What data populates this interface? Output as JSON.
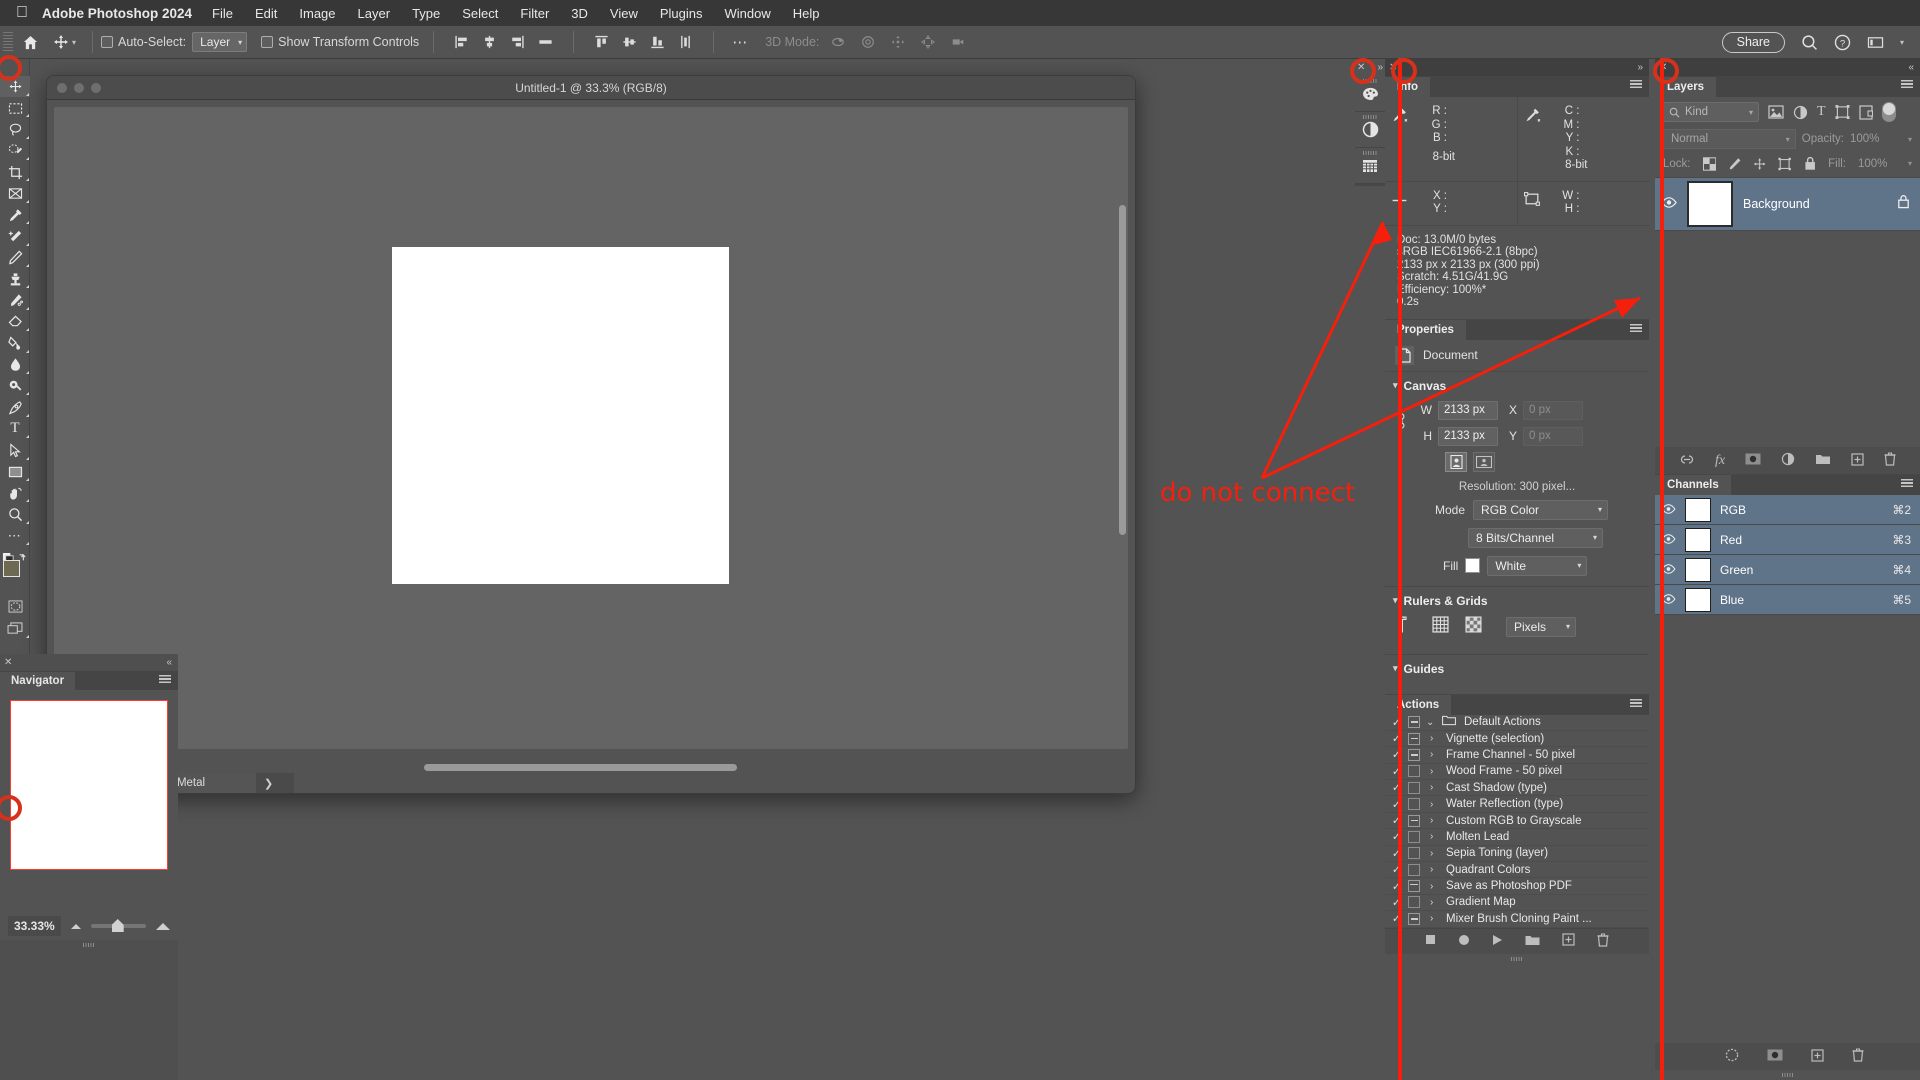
{
  "colors": {
    "annotation_red": "#f61f0c",
    "panel_bg": "#535353",
    "selection_blue": "#5f7389",
    "app_chrome": "#373737"
  },
  "menubar": {
    "apple_glyph": "apple-logo",
    "app_name": "Adobe Photoshop 2024",
    "items": [
      "File",
      "Edit",
      "Image",
      "Layer",
      "Type",
      "Select",
      "Filter",
      "3D",
      "View",
      "Plugins",
      "Window",
      "Help"
    ]
  },
  "optionsbar": {
    "home_icon": "home-icon",
    "tool_icon": "move-tool-icon",
    "auto_select_label": "Auto-Select:",
    "auto_select_checked": false,
    "layer_dropdown_value": "Layer",
    "show_transform_label": "Show Transform Controls",
    "show_transform_checked": false,
    "align_icons": [
      "align-left-edges-icon",
      "align-horizontal-centers-icon",
      "align-right-edges-icon",
      "align-center-icon"
    ],
    "distribute_icons": [
      "align-top-edges-icon",
      "align-vertical-centers-icon",
      "align-bottom-edges-icon",
      "distribute-vertical-icon"
    ],
    "more_icon": "ellipsis-icon",
    "mode3d_label": "3D Mode:",
    "mode3d_icons": [
      "orbit-3d-icon",
      "roll-3d-icon",
      "pan-3d-icon",
      "slide-3d-icon",
      "camera-3d-icon"
    ],
    "share_label": "Share",
    "search_icon": "search-icon",
    "help_icon": "help-circle-icon",
    "workspace_icon": "workspace-icon",
    "workspace_caret": "chevron-down-icon"
  },
  "toolbar": {
    "close_icon": "close-icon",
    "expand_icon": "double-chevron-right-icon",
    "tools": [
      {
        "name": "move-tool",
        "glyph": "✛",
        "active": true
      },
      {
        "name": "rectangular-marquee-tool",
        "glyph": "⬚",
        "active": false
      },
      {
        "name": "lasso-tool",
        "glyph": "◯",
        "active": false
      },
      {
        "name": "object-selection-tool",
        "glyph": "✐",
        "active": false
      },
      {
        "name": "crop-tool",
        "glyph": "⌙",
        "active": false
      },
      {
        "name": "frame-tool",
        "glyph": "⌧",
        "active": false
      },
      {
        "name": "eyedropper-tool",
        "glyph": "✒",
        "active": false
      },
      {
        "name": "spot-healing-brush-tool",
        "glyph": "✦",
        "active": false
      },
      {
        "name": "brush-tool",
        "glyph": "✎",
        "active": false
      },
      {
        "name": "clone-stamp-tool",
        "glyph": "⚑",
        "active": false
      },
      {
        "name": "history-brush-tool",
        "glyph": "✐",
        "active": false
      },
      {
        "name": "eraser-tool",
        "glyph": "▱",
        "active": false
      },
      {
        "name": "gradient-tool",
        "glyph": "◢",
        "active": false
      },
      {
        "name": "blur-tool",
        "glyph": "●",
        "active": false
      },
      {
        "name": "dodge-tool",
        "glyph": "◔",
        "active": false
      },
      {
        "name": "pen-tool",
        "glyph": "✒",
        "active": false
      },
      {
        "name": "type-tool",
        "glyph": "T",
        "active": false
      },
      {
        "name": "path-selection-tool",
        "glyph": "➤",
        "active": false
      },
      {
        "name": "rectangle-tool",
        "glyph": "▭",
        "active": false
      },
      {
        "name": "hand-tool",
        "glyph": "✋",
        "active": false
      },
      {
        "name": "zoom-tool",
        "glyph": "⚲",
        "active": false
      },
      {
        "name": "edit-toolbar",
        "glyph": "…",
        "active": false
      }
    ],
    "foreground_color": "#6e6a52",
    "background_color": "#4a4a3c",
    "quickmask_icon": "quick-mask-icon",
    "screenmode_icon": "screen-mode-icon"
  },
  "document": {
    "title": "Untitled-1 @ 33.3% (RGB/8)",
    "status_zoom": "33.33%",
    "status_engine": "Metal",
    "status_arrow": "❯"
  },
  "navigator": {
    "close_icon": "close-icon",
    "collapse_icon": "double-chevron-left-icon",
    "tab_label": "Navigator",
    "menu_icon": "panel-menu-icon",
    "zoom_value": "33.33%",
    "zoom_out_icon": "zoom-out-icon",
    "zoom_in_icon": "zoom-in-icon"
  },
  "iconstrip": {
    "close_icon": "close-icon",
    "expand_icon": "double-chevron-right-icon",
    "buttons": [
      {
        "name": "color-panel-icon",
        "glyph": "⚘"
      },
      {
        "name": "adjustments-panel-icon",
        "glyph": "◑"
      },
      {
        "name": "libraries-panel-icon",
        "glyph": "▦"
      }
    ]
  },
  "info": {
    "close_icon": "close-icon",
    "collapse_icon": "double-chevron-right-icon",
    "tab_label": "Info",
    "menu_icon": "panel-menu-icon",
    "rgb": {
      "icon": "eyedropper-icon",
      "labels": [
        "R :",
        "G :",
        "B :"
      ],
      "depth": "8-bit"
    },
    "cmyk": {
      "icon": "eyedropper-icon",
      "labels": [
        "C :",
        "M :",
        "Y :",
        "K :"
      ],
      "depth": "8-bit"
    },
    "position": {
      "icon": "crosshair-icon",
      "labels": [
        "X :",
        "Y :"
      ]
    },
    "dimensions": {
      "icon": "marquee-icon",
      "labels": [
        "W :",
        "H :"
      ]
    },
    "doc_lines": [
      "Doc: 13.0M/0 bytes",
      "sRGB IEC61966-2.1 (8bpc)",
      "2133 px x 2133 px (300 ppi)",
      "Scratch: 4.51G/41.9G",
      "Efficiency: 100%*",
      "0.2s"
    ]
  },
  "properties": {
    "tab_label": "Properties",
    "menu_icon": "panel-menu-icon",
    "doc_icon": "document-icon",
    "doc_label": "Document",
    "canvas_section": "Canvas",
    "link_icon": "link-icon",
    "w_label": "W",
    "w_value": "2133 px",
    "h_label": "H",
    "h_value": "2133 px",
    "x_label": "X",
    "x_placeholder": "0 px",
    "y_label": "Y",
    "y_placeholder": "0 px",
    "orientation_portrait_icon": "portrait-orientation-icon",
    "orientation_landscape_icon": "landscape-orientation-icon",
    "resolution_text": "Resolution: 300 pixel...",
    "mode_label": "Mode",
    "mode_value": "RGB Color",
    "bits_value": "8 Bits/Channel",
    "fill_label": "Fill",
    "fill_swatch": "#ffffff",
    "fill_value": "White",
    "rulers_section": "Rulers & Grids",
    "ruler_icon": "ruler-icon",
    "grid_icon": "grid-icon",
    "transparency_icon": "transparency-grid-icon",
    "units_value": "Pixels",
    "guides_section": "Guides"
  },
  "actions": {
    "tab_label": "Actions",
    "menu_icon": "panel-menu-icon",
    "items": [
      {
        "label": "Default Actions",
        "checked": true,
        "box": "dash",
        "chevron": "⌄",
        "folder": true,
        "indent": 0
      },
      {
        "label": "Vignette (selection)",
        "checked": true,
        "box": "dash",
        "chevron": "›",
        "folder": false,
        "indent": 1
      },
      {
        "label": "Frame Channel - 50 pixel",
        "checked": true,
        "box": "dash",
        "chevron": "›",
        "folder": false,
        "indent": 1
      },
      {
        "label": "Wood Frame - 50 pixel",
        "checked": true,
        "box": "empty",
        "chevron": "›",
        "folder": false,
        "indent": 1
      },
      {
        "label": "Cast Shadow (type)",
        "checked": true,
        "box": "empty",
        "chevron": "›",
        "folder": false,
        "indent": 1
      },
      {
        "label": "Water Reflection (type)",
        "checked": true,
        "box": "empty",
        "chevron": "›",
        "folder": false,
        "indent": 1
      },
      {
        "label": "Custom RGB to Grayscale",
        "checked": true,
        "box": "dash",
        "chevron": "›",
        "folder": false,
        "indent": 1
      },
      {
        "label": "Molten Lead",
        "checked": true,
        "box": "empty",
        "chevron": "›",
        "folder": false,
        "indent": 1
      },
      {
        "label": "Sepia Toning (layer)",
        "checked": true,
        "box": "empty",
        "chevron": "›",
        "folder": false,
        "indent": 1
      },
      {
        "label": "Quadrant Colors",
        "checked": true,
        "box": "empty",
        "chevron": "›",
        "folder": false,
        "indent": 1
      },
      {
        "label": "Save as Photoshop PDF",
        "checked": true,
        "box": "full",
        "chevron": "›",
        "folder": false,
        "indent": 1
      },
      {
        "label": "Gradient Map",
        "checked": true,
        "box": "empty",
        "chevron": "›",
        "folder": false,
        "indent": 1
      },
      {
        "label": "Mixer Brush Cloning Paint ...",
        "checked": true,
        "box": "dash",
        "chevron": "›",
        "folder": false,
        "indent": 1
      }
    ],
    "footer_icons": [
      "stop-icon",
      "record-icon",
      "play-icon",
      "new-set-icon",
      "new-action-icon",
      "delete-icon"
    ]
  },
  "layers": {
    "close_icon": "close-icon",
    "collapse_icon": "double-chevron-left-icon",
    "tab_label": "Layers",
    "menu_icon": "panel-menu-icon",
    "filter_placeholder": "Kind",
    "filter_search_icon": "search-icon",
    "filter_icons": [
      "pixel-layer-filter-icon",
      "adjustment-layer-filter-icon",
      "type-layer-filter-icon",
      "shape-layer-filter-icon",
      "smart-object-filter-icon"
    ],
    "filter_toggle": "filter-toggle",
    "blend_mode": "Normal",
    "opacity_label": "Opacity:",
    "opacity_value": "100%",
    "lock_label": "Lock:",
    "lock_icons": [
      "lock-transparent-pixels-icon",
      "lock-image-pixels-icon",
      "lock-position-icon",
      "lock-artboard-icon",
      "lock-all-icon"
    ],
    "fill_label": "Fill:",
    "fill_value": "100%",
    "rows": [
      {
        "name": "Background",
        "visible": true,
        "locked": true,
        "lock_icon": "lock-icon",
        "eye_icon": "eye-icon"
      }
    ],
    "footer_icons": [
      "link-layers-icon",
      "layer-style-fx-icon",
      "layer-mask-icon",
      "adjustment-layer-icon",
      "new-group-icon",
      "new-layer-icon",
      "delete-layer-icon"
    ]
  },
  "channels": {
    "tab_label": "Channels",
    "menu_icon": "panel-menu-icon",
    "rows": [
      {
        "name": "RGB",
        "shortcut": "⌘2",
        "visible": true
      },
      {
        "name": "Red",
        "shortcut": "⌘3",
        "visible": true
      },
      {
        "name": "Green",
        "shortcut": "⌘4",
        "visible": true
      },
      {
        "name": "Blue",
        "shortcut": "⌘5",
        "visible": true
      }
    ],
    "footer_icons": [
      "load-channel-as-selection-icon",
      "save-selection-as-channel-icon",
      "new-channel-icon",
      "delete-channel-icon"
    ]
  },
  "annotation": {
    "text": "do not connect",
    "color": "#f61f0c",
    "highlight_rings": 4,
    "vertical_line_count": 2
  }
}
